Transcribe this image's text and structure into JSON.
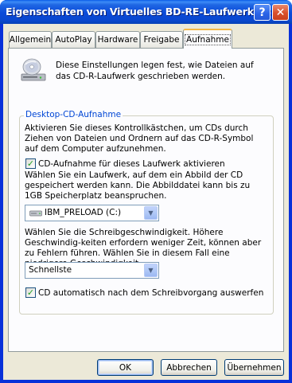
{
  "window": {
    "title": "Eigenschaften von Virtuelles BD-RE-Laufwerk (F:)",
    "help_label": "?",
    "close_label": "✕"
  },
  "tabs": [
    {
      "label": "Allgemein"
    },
    {
      "label": "AutoPlay"
    },
    {
      "label": "Hardware"
    },
    {
      "label": "Freigabe"
    },
    {
      "label": "Aufnahme",
      "active": true
    }
  ],
  "intro": "Diese Einstellungen legen fest, wie Dateien auf das CD-R-Laufwerk geschrieben werden.",
  "group": {
    "title": "Desktop-CD-Aufnahme",
    "desc1": "Aktivieren Sie dieses Kontrollkästchen, um CDs durch Ziehen von Dateien und Ordnern auf das CD-R-Symbol auf dem Computer aufzunehmen.",
    "enable_label": "CD-Aufnahme für dieses Laufwerk aktivieren",
    "enable_checked": true,
    "desc2": "Wählen Sie ein Laufwerk, auf dem ein Abbild der CD gespeichert werden kann. Die Abbilddatei kann bis zu 1GB Speicherplatz beanspruchen.",
    "drive_value": "IBM_PRELOAD (C:)",
    "desc3": "Wählen Sie die Schreibgeschwindigkeit. Höhere Geschwindig-keiten erfordern weniger Zeit, können aber zu Fehlern führen. Wählen Sie in diesem Fall eine niedrigere Geschwindigkeit.",
    "speed_value": "Schnellste",
    "eject_label": "CD automatisch nach dem Schreibvorgang auswerfen",
    "eject_checked": true
  },
  "buttons": {
    "ok": "OK",
    "cancel": "Abbrechen",
    "apply": "Übernehmen"
  },
  "colors": {
    "title_bar": "#0a47cf",
    "dialog_bg": "#ece9d8",
    "group_title": "#0046d5",
    "check_mark": "#21a121"
  },
  "icons": {
    "cd": "cd-drive-icon",
    "drive": "hard-drive-icon",
    "dropdown": "chevron-down-icon"
  }
}
